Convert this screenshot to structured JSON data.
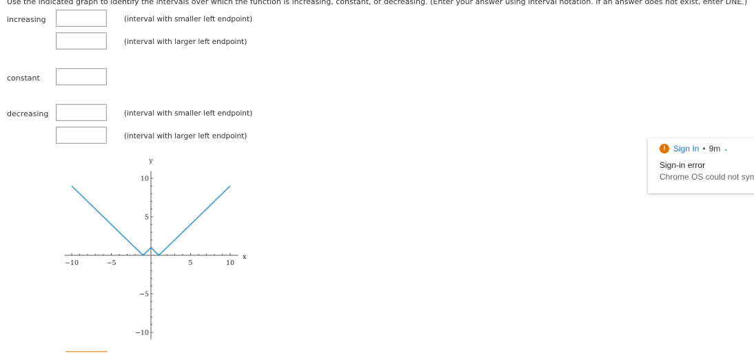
{
  "instructions": "Use the indicated graph to identify the intervals over which the function is increasing, constant, or decreasing. (Enter your answer using interval notation. If an answer does not exist, enter DNE.)",
  "rows": {
    "increasing": {
      "label": "increasing",
      "hint1": "(interval with smaller left endpoint)",
      "hint2": "(interval with larger left endpoint)",
      "value1": "",
      "value2": ""
    },
    "constant": {
      "label": "constant",
      "value1": ""
    },
    "decreasing": {
      "label": "decreasing",
      "hint1": "(interval with smaller left endpoint)",
      "hint2": "(interval with larger left endpoint)",
      "value1": "",
      "value2": ""
    }
  },
  "chart_data": {
    "type": "line",
    "xlabel": "x",
    "ylabel": "y",
    "xlim": [
      -12,
      13
    ],
    "ylim": [
      -11,
      12
    ],
    "xticks": [
      -10,
      -5,
      5,
      10
    ],
    "yticks": [
      10,
      5,
      -5,
      -10
    ],
    "line_color": "#3a9ad9",
    "series": [
      {
        "x": [
          -10,
          -1,
          0,
          1,
          10
        ],
        "y": [
          9,
          0,
          1,
          0,
          9
        ]
      }
    ]
  },
  "notification": {
    "app": "Sign In",
    "time": "9m",
    "title": "Sign-in error",
    "message": "Chrome OS could not sync",
    "icon": "warning-icon",
    "accent": "#e37400"
  }
}
